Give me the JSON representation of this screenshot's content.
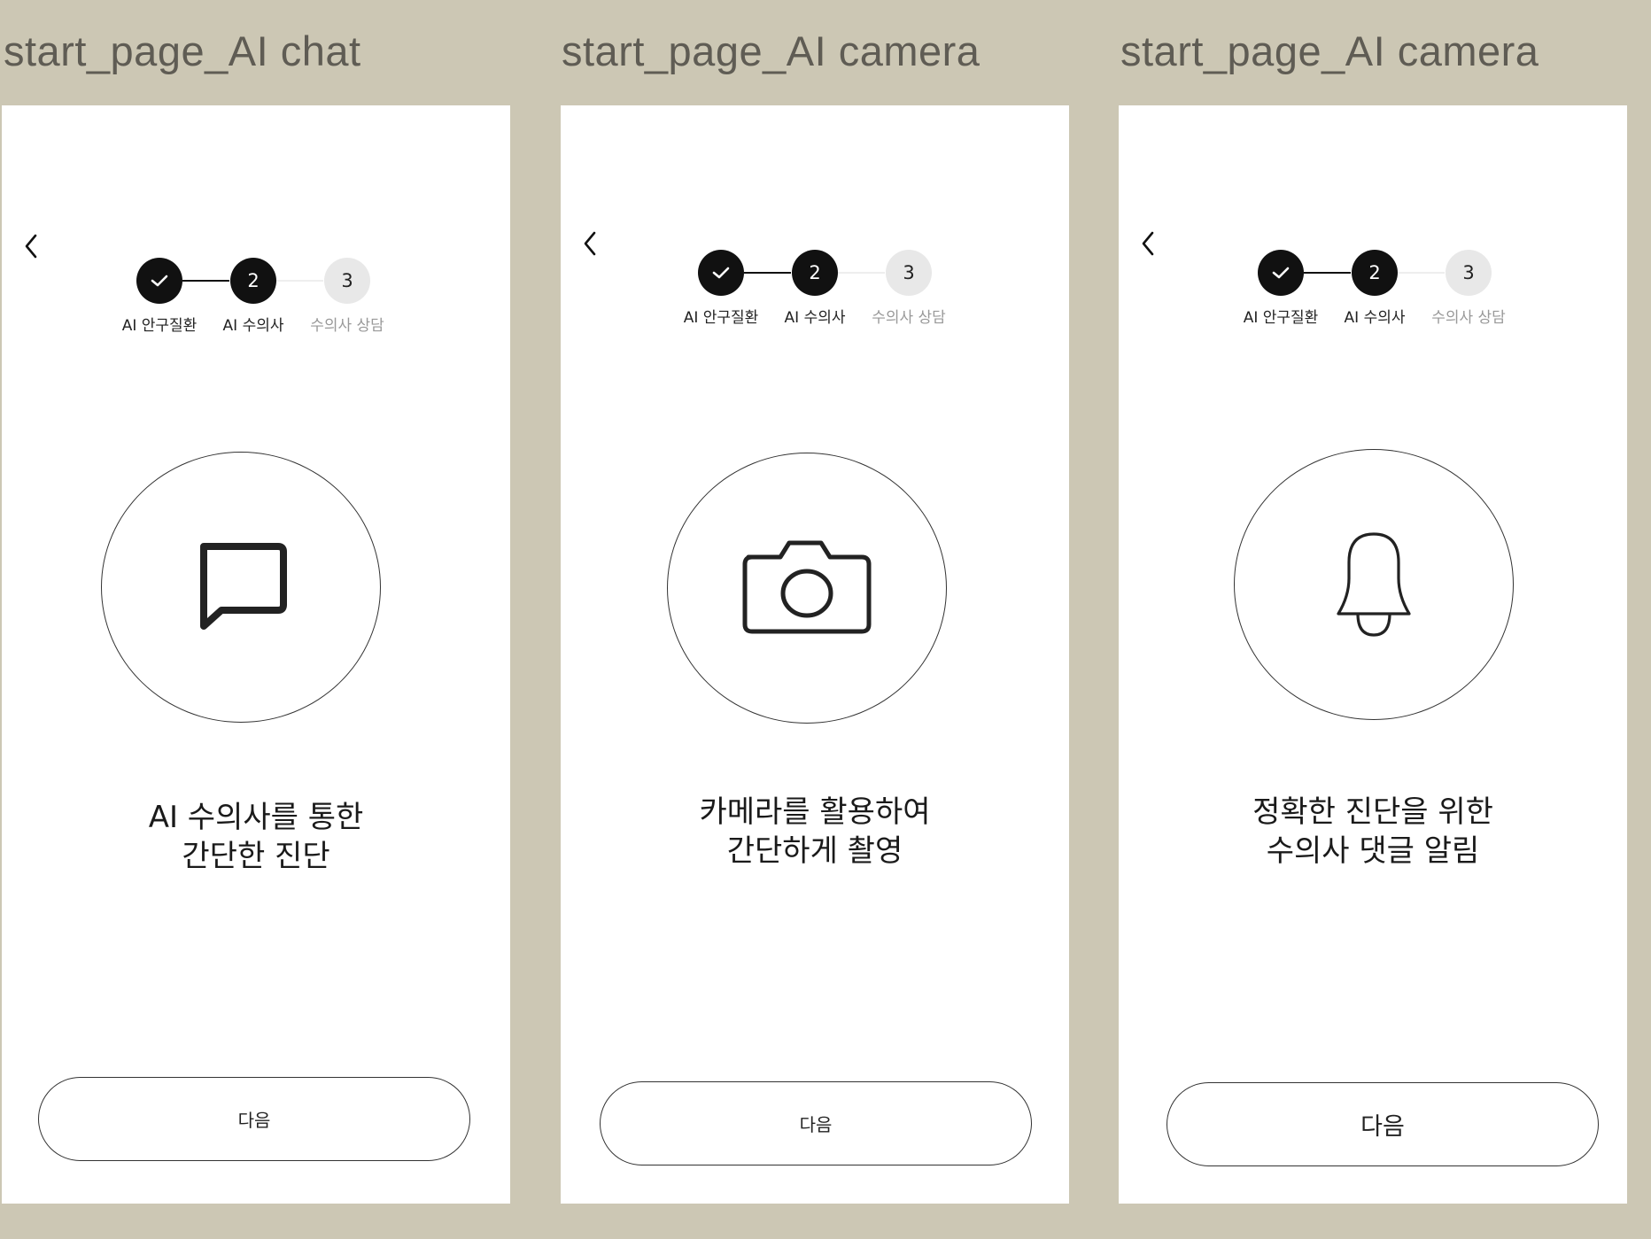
{
  "frames": [
    {
      "title": "start_page_AI chat",
      "steps": [
        {
          "label": "AI 안구질환",
          "state": "done"
        },
        {
          "label": "AI 수의사",
          "number": "2",
          "state": "current"
        },
        {
          "label": "수의사 상담",
          "number": "3",
          "state": "upcoming"
        }
      ],
      "icon": "chat-bubble-icon",
      "caption_lines": [
        "AI 수의사를 통한",
        "간단한 진단"
      ],
      "next_label": "다음"
    },
    {
      "title": "start_page_AI camera",
      "steps": [
        {
          "label": "AI 안구질환",
          "state": "done"
        },
        {
          "label": "AI 수의사",
          "number": "2",
          "state": "current"
        },
        {
          "label": "수의사 상담",
          "number": "3",
          "state": "upcoming"
        }
      ],
      "icon": "camera-icon",
      "caption_lines": [
        "카메라를 활용하여",
        "간단하게 촬영"
      ],
      "next_label": "다음"
    },
    {
      "title": "start_page_AI camera",
      "steps": [
        {
          "label": "AI 안구질환",
          "state": "done"
        },
        {
          "label": "AI 수의사",
          "number": "2",
          "state": "current"
        },
        {
          "label": "수의사 상담",
          "number": "3",
          "state": "upcoming"
        }
      ],
      "icon": "bell-icon",
      "caption_lines": [
        "정확한 진단을 위한",
        "수의사 댓글 알림"
      ],
      "next_label": "다음"
    }
  ],
  "colors": {
    "canvas": "#ccc7b4",
    "screen": "#ffffff",
    "step_active": "#111111",
    "step_inactive": "#e8e8e8",
    "label_muted": "#999999"
  }
}
